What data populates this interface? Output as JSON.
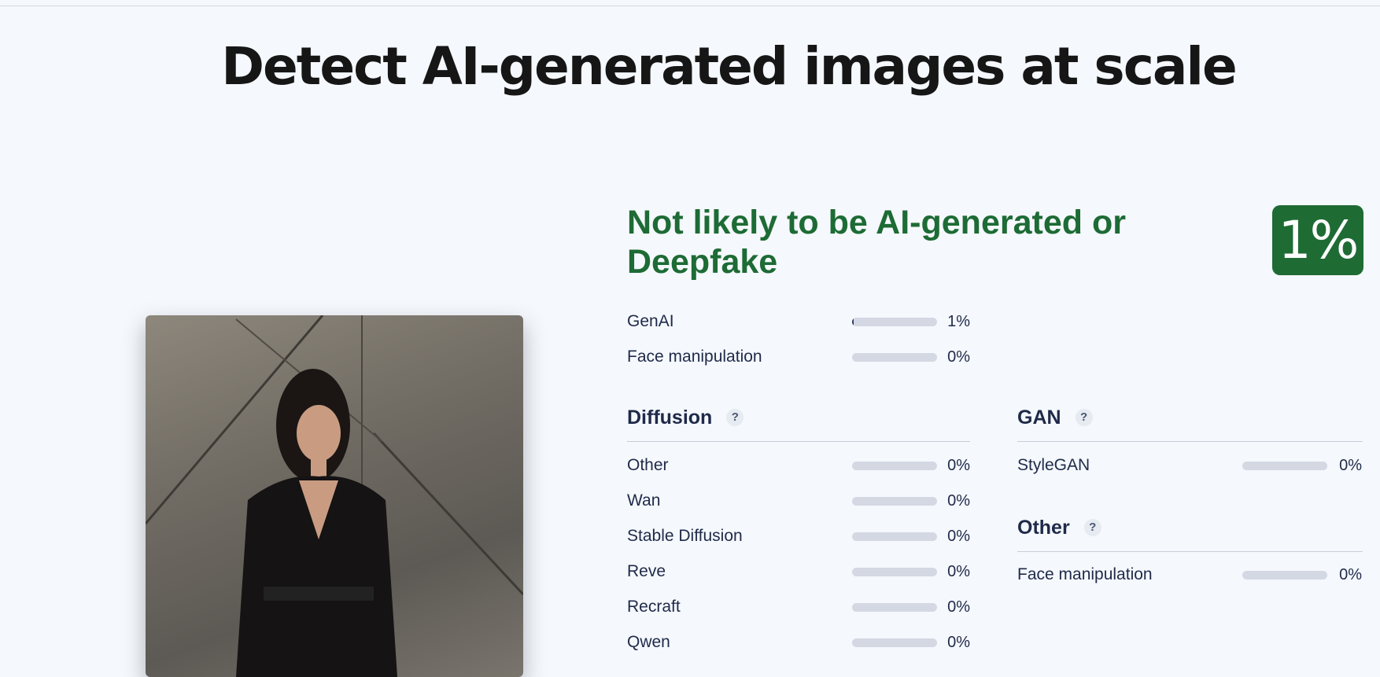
{
  "title": "Detect AI-generated images at scale",
  "verdict": "Not likely to be AI-generated or Deepfake",
  "overall_score": "1%",
  "colors": {
    "verdict_green": "#1d6b35",
    "badge_green": "#1f6b34",
    "bar_track": "#d3d8e3"
  },
  "summary": [
    {
      "label": "GenAI",
      "value": "1%",
      "level": 0.01
    },
    {
      "label": "Face manipulation",
      "value": "0%",
      "level": 0
    }
  ],
  "diffusion": {
    "heading": "Diffusion",
    "help": "?",
    "items": [
      {
        "label": "Other",
        "value": "0%",
        "level": 0
      },
      {
        "label": "Wan",
        "value": "0%",
        "level": 0
      },
      {
        "label": "Stable Diffusion",
        "value": "0%",
        "level": 0
      },
      {
        "label": "Reve",
        "value": "0%",
        "level": 0
      },
      {
        "label": "Recraft",
        "value": "0%",
        "level": 0
      },
      {
        "label": "Qwen",
        "value": "0%",
        "level": 0
      }
    ]
  },
  "gan": {
    "heading": "GAN",
    "help": "?",
    "items": [
      {
        "label": "StyleGAN",
        "value": "0%",
        "level": 0
      }
    ]
  },
  "other": {
    "heading": "Other",
    "help": "?",
    "items": [
      {
        "label": "Face manipulation",
        "value": "0%",
        "level": 0
      }
    ]
  }
}
